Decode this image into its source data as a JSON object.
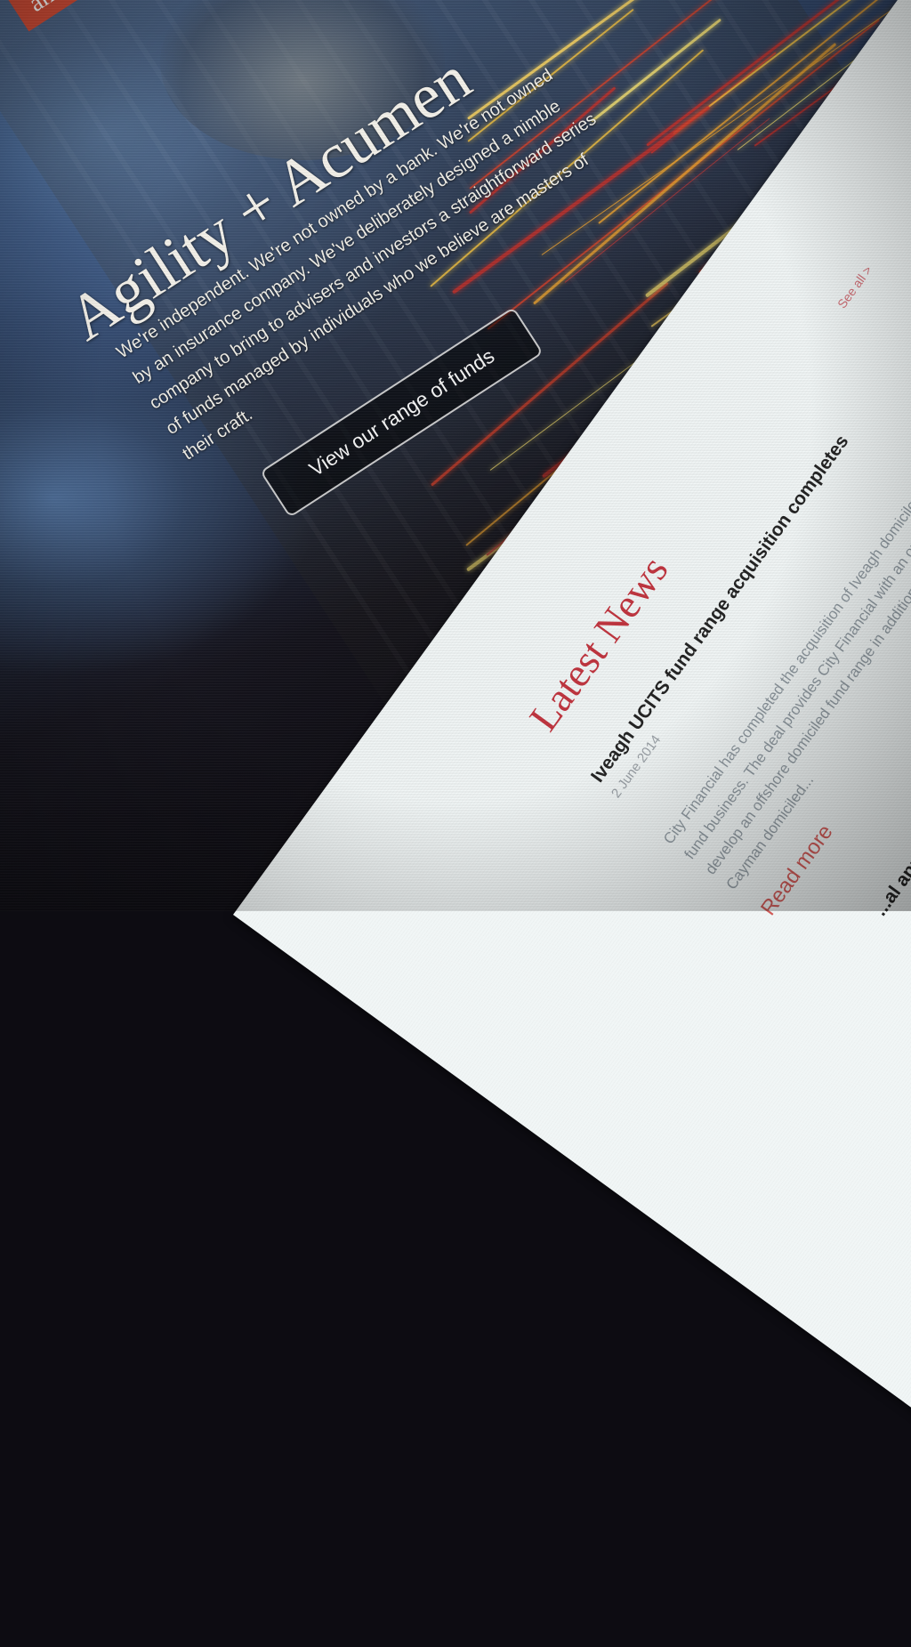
{
  "brand": {
    "label": "ancial"
  },
  "hero": {
    "title": "Agility + Acumen",
    "description": "We're independent. We're not owned by a bank. We're not owned by an insurance company. We've deliberately designed a nimble company to bring to advisers and investors a straightforward series of funds managed by individuals who we believe are masters of their craft.",
    "cta_label": "View our range of funds"
  },
  "news": {
    "heading": "Latest News",
    "see_all": "See all >",
    "articles": [
      {
        "title": "Iveagh UCITS fund range acquisition completes",
        "date": "2 June 2014",
        "body": "City Financial has completed the acquisition of Iveagh domiciled UCITS fund business. The deal provides City Financial with an opportunity to develop an offshore domiciled fund range in addition to its existing UK and Cayman domiciled...",
        "read_more": "Read more"
      },
      {
        "title": "...al app"
      }
    ]
  },
  "colors": {
    "accent": "#c0343e",
    "brand_red": "#d04b35",
    "panel_bg": "#f1f6f6"
  }
}
